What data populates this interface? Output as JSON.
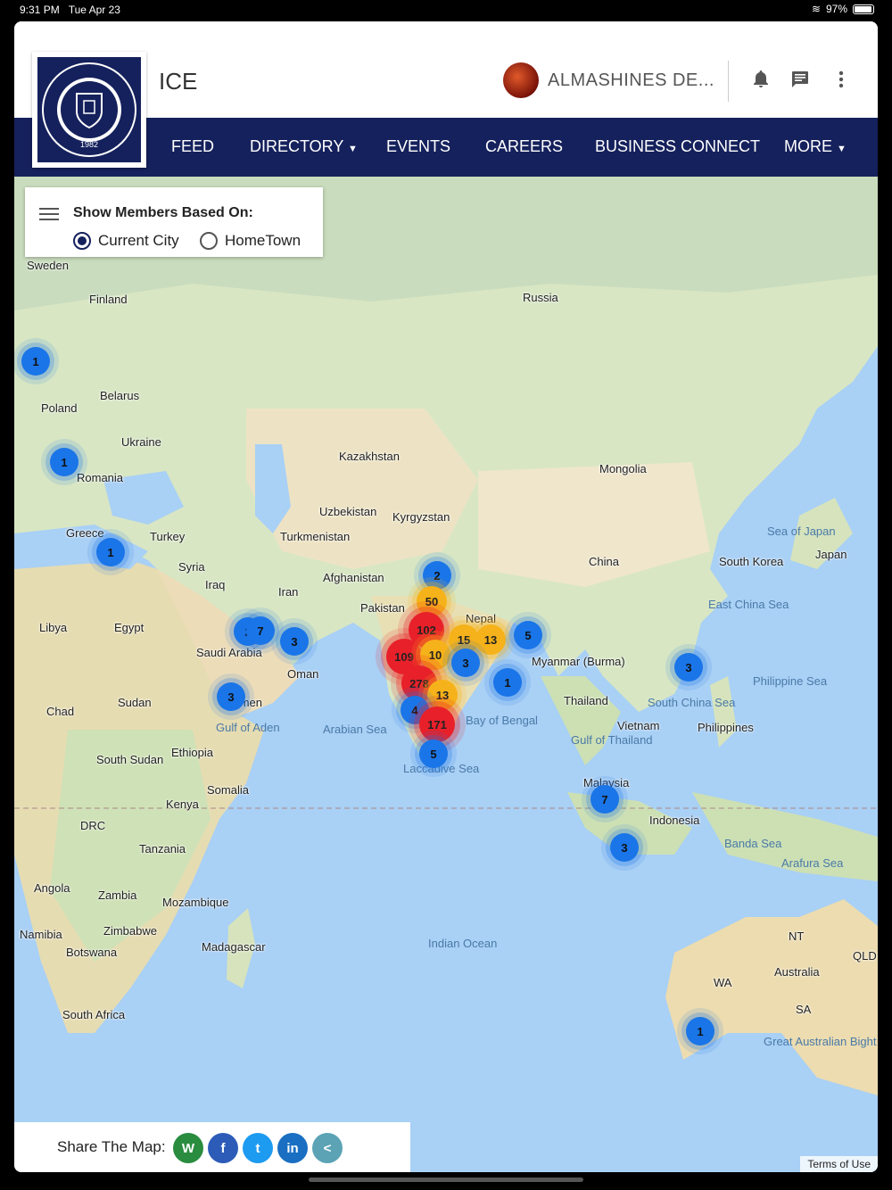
{
  "status": {
    "time": "9:31 PM",
    "date": "Tue Apr 23",
    "battery": "97%"
  },
  "header": {
    "title": "ICE",
    "logo_text": "EDEH VOCATIONAL COLLEGE FOR CORRECTIONAL POLICE 1982",
    "profile_name": "ALMASHINES DE..."
  },
  "nav": {
    "feed": "FEED",
    "directory": "DIRECTORY",
    "events": "EVENTS",
    "careers": "CAREERS",
    "business": "BUSINESS CONNECT",
    "more": "MORE"
  },
  "filter": {
    "title": "Show Members Based On:",
    "option_city": "Current City",
    "option_hometown": "HomeTown",
    "selected": "Current City"
  },
  "places": [
    "Sweden",
    "Finland",
    "Russia",
    "Poland",
    "Belarus",
    "Ukraine",
    "Romania",
    "Kazakhstan",
    "Mongolia",
    "Uzbekistan",
    "Kyrgyzstan",
    "Turkmenistan",
    "Greece",
    "Turkey",
    "Syria",
    "Iraq",
    "Iran",
    "Afghanistan",
    "Pakistan",
    "China",
    "South Korea",
    "Japan",
    "Sea of Japan",
    "East China Sea",
    "Libya",
    "Egypt",
    "Saudi Arabia",
    "Oman",
    "Nepal",
    "Myanmar (Burma)",
    "Thailand",
    "Philippine Sea",
    "South China Sea",
    "Vietnam",
    "Philippines",
    "Yemen",
    "Gulf of Aden",
    "Arabian Sea",
    "Bay of Bengal",
    "Laccadive Sea",
    "Gulf of Thailand",
    "Chad",
    "Sudan",
    "South Sudan",
    "Ethiopia",
    "Somalia",
    "Kenya",
    "Malaysia",
    "Indonesia",
    "Banda Sea",
    "Arafura Sea",
    "DRC",
    "Tanzania",
    "Angola",
    "Zambia",
    "Mozambique",
    "Namibia",
    "Zimbabwe",
    "Botswana",
    "Madagascar",
    "Indian Ocean",
    "South Africa",
    "Australia",
    "NT",
    "WA",
    "SA",
    "QLD",
    "Great Australian Bight"
  ],
  "clusters": [
    {
      "label": "1",
      "level": "blue"
    },
    {
      "label": "1",
      "level": "blue"
    },
    {
      "label": "1",
      "level": "blue"
    },
    {
      "label": "2",
      "level": "blue"
    },
    {
      "label": "50",
      "level": "yellow"
    },
    {
      "label": "102",
      "level": "red"
    },
    {
      "label": "15",
      "level": "yellow"
    },
    {
      "label": "13",
      "level": "yellow"
    },
    {
      "label": "5",
      "level": "blue"
    },
    {
      "label": "109",
      "level": "red"
    },
    {
      "label": "10",
      "level": "yellow"
    },
    {
      "label": "3",
      "level": "blue"
    },
    {
      "label": "1",
      "level": "blue"
    },
    {
      "label": "278",
      "level": "red"
    },
    {
      "label": "13",
      "level": "yellow"
    },
    {
      "label": "4",
      "level": "blue"
    },
    {
      "label": "171",
      "level": "red"
    },
    {
      "label": "5",
      "level": "blue"
    },
    {
      "label": "3",
      "level": "blue"
    },
    {
      "label": "7",
      "level": "blue"
    },
    {
      "label": "3",
      "level": "blue"
    },
    {
      "label": "2",
      "level": "blue"
    },
    {
      "label": "3",
      "level": "blue"
    },
    {
      "label": "7",
      "level": "blue"
    },
    {
      "label": "3",
      "level": "blue"
    },
    {
      "label": "1",
      "level": "blue"
    }
  ],
  "share": {
    "label": "Share The Map:",
    "whatsapp": "W",
    "facebook": "f",
    "twitter": "t",
    "linkedin": "in",
    "share": "<"
  },
  "terms": "Terms of Use",
  "colors": {
    "navy": "#15215c",
    "cluster_blue": "#1a75e8",
    "cluster_yellow": "#f6b21a",
    "cluster_red": "#e8202a",
    "whatsapp": "#2a8c3f",
    "facebook": "#2d5cb8",
    "twitter": "#1d9bf0",
    "linkedin": "#1a6fc2",
    "share": "#5ba3b5"
  }
}
